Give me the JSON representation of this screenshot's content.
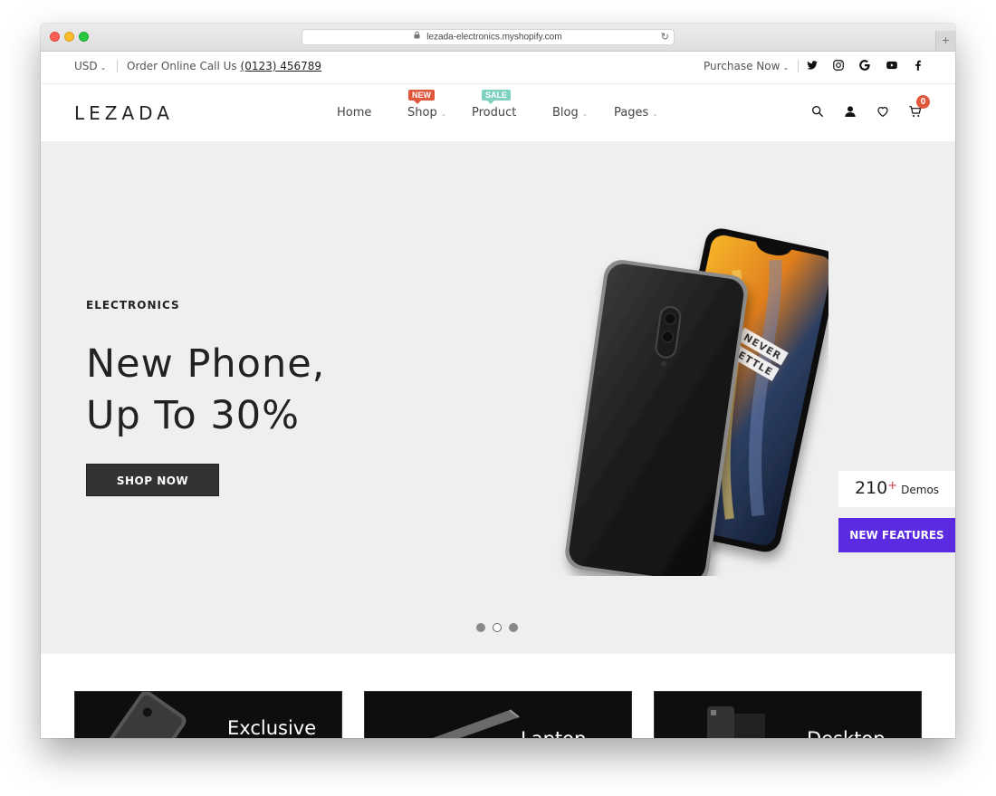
{
  "browser": {
    "url": "lezada-electronics.myshopify.com"
  },
  "topbar": {
    "currency": "USD",
    "order_text": "Order Online Call Us",
    "phone": "(0123) 456789",
    "purchase_label": "Purchase Now",
    "social_icons": [
      "twitter-icon",
      "instagram-icon",
      "google-icon",
      "youtube-icon",
      "facebook-icon"
    ]
  },
  "header": {
    "logo": "LEZADA",
    "nav": [
      {
        "label": "Home"
      },
      {
        "label": "Shop",
        "badge": "NEW"
      },
      {
        "label": "Product",
        "badge": "SALE"
      },
      {
        "label": "Blog"
      },
      {
        "label": "Pages"
      }
    ],
    "cart_count": "0"
  },
  "hero": {
    "eyebrow": "ELECTRONICS",
    "title_line1": "New Phone,",
    "title_line2": "Up To 30%",
    "cta": "SHOP NOW",
    "phone_screen_text_1": "NEVER",
    "phone_screen_text_2": "SETTLE"
  },
  "side_widget": {
    "demos_count": "210",
    "demos_plus": "+",
    "demos_label": "Demos",
    "new_features": "NEW FEATURES"
  },
  "categories": [
    {
      "label": "Exclusive"
    },
    {
      "label": "Laptop"
    },
    {
      "label": "Desktop"
    }
  ],
  "colors": {
    "accent_purple": "#5a2be0",
    "badge_new": "#e0583b",
    "badge_sale": "#7fd1c0",
    "hero_bg": "#efefef"
  }
}
